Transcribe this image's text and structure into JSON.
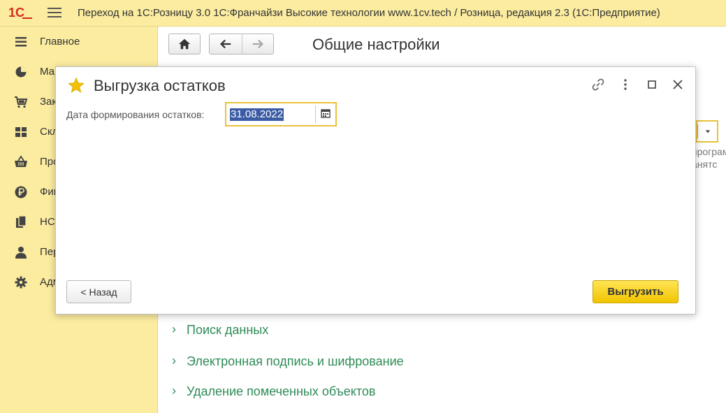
{
  "window": {
    "title": "Переход на 1С:Розницу 3.0  1С:Франчайзи Высокие технологии  www.1cv.tech / Розница, редакция 2.3  (1С:Предприятие)",
    "logo_icon": "1c-logo-icon",
    "menu_icon": "hamburger-icon"
  },
  "sidebar": {
    "items": [
      {
        "label": "Главное",
        "icon": "list-icon"
      },
      {
        "label": "Ма",
        "icon": "pie-chart-icon"
      },
      {
        "label": "Зак",
        "icon": "cart-icon"
      },
      {
        "label": "Скл",
        "icon": "warehouse-icon"
      },
      {
        "label": "Про",
        "icon": "basket-icon"
      },
      {
        "label": "Фин",
        "icon": "ruble-icon"
      },
      {
        "label": "НС",
        "icon": "documents-icon"
      },
      {
        "label": "Пер",
        "icon": "person-icon"
      },
      {
        "label": "Адм",
        "icon": "gear-icon"
      }
    ]
  },
  "main": {
    "page_title": "Общие настройки",
    "bg_fragments": [
      "програм",
      "анятс"
    ],
    "sections": [
      {
        "label": "Поиск данных"
      },
      {
        "label": "Электронная подпись и шифрование"
      },
      {
        "label": "Удаление помеченных объектов"
      }
    ]
  },
  "dialog": {
    "title": "Выгрузка остатков",
    "field_label": "Дата формирования остатков:",
    "date_value": "31.08.2022",
    "back_label": "< Назад",
    "export_label": "Выгрузить"
  },
  "colors": {
    "panel_bg": "#fbeca0",
    "link_green": "#2e8b57",
    "accent_yellow": "#f1c500",
    "focus_border": "#e8c23a",
    "logo_red": "#d52b1e"
  }
}
